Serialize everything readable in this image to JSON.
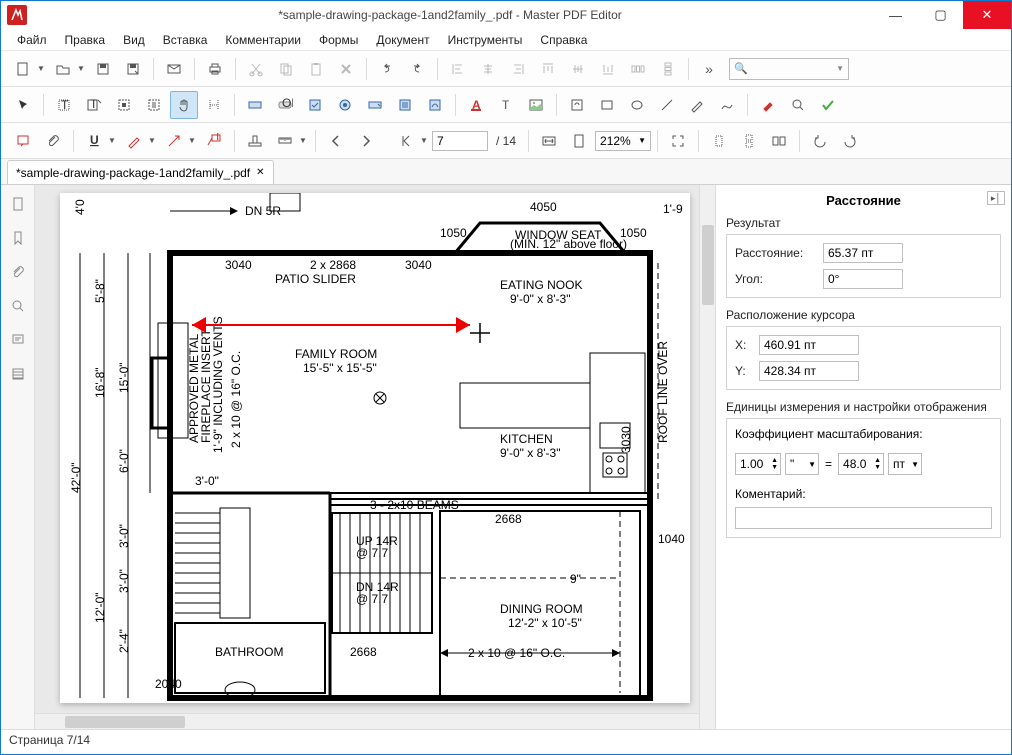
{
  "window": {
    "title": "*sample-drawing-package-1and2family_.pdf - Master PDF Editor",
    "app_name": "Master PDF Editor"
  },
  "menu": [
    "Файл",
    "Правка",
    "Вид",
    "Вставка",
    "Комментарии",
    "Формы",
    "Документ",
    "Инструменты",
    "Справка"
  ],
  "toolbar": {
    "search_icon": "🔍",
    "page_current": "7",
    "page_total": "/ 14",
    "zoom": "212%"
  },
  "tab": {
    "label": "*sample-drawing-package-1and2family_.pdf",
    "close": "✕"
  },
  "status": {
    "text": "Страница 7/14"
  },
  "side": {
    "title": "Расстояние",
    "result_heading": "Результат",
    "distance_label": "Расстояние:",
    "distance_value": "65.37 пт",
    "angle_label": "Угол:",
    "angle_value": "0°",
    "cursor_heading": "Расположение курсора",
    "x_label": "X:",
    "x_value": "460.91 пт",
    "y_label": "Y:",
    "y_value": "428.34 пт",
    "units_heading": "Единицы измерения и настройки отображения",
    "scale_label": "Коэффициент масштабирования:",
    "scale_a": "1.00",
    "scale_unit_a": "\"",
    "equals": "=",
    "scale_b": "48.0",
    "scale_unit_b": "пт",
    "comment_label": "Коментарий:",
    "comment_value": ""
  },
  "floorplan": {
    "dn5r": "DN 5R",
    "d4050": "4050",
    "d1050a": "1050",
    "d1050b": "1050",
    "d19": "1'-9",
    "d40": "4'0",
    "window_seat": "WINDOW SEAT",
    "window_seat_sub": "(MIN. 12\" above floor)",
    "d3040a": "3040",
    "d2x2868": "2 x 2868",
    "d3040b": "3040",
    "patio_slider": "PATIO SLIDER",
    "eating_nook": "EATING NOOK",
    "eating_nook_dim": "9'-0\" x 8'-3\"",
    "family_room": "FAMILY ROOM",
    "family_room_dim": "15'-5\" x 15'-5\"",
    "kitchen": "KITCHEN",
    "kitchen_dim": "9'-0\" x 8'-3\"",
    "roof_line": "ROOF LINE OVER",
    "approved_metal": "APPROVED METAL",
    "fireplace_insert": "FIREPLACE INSERT",
    "including_vents": "1'-9\" INCLUDING VENTS",
    "d2x10_16": "2 x 10 @ 16\" O.C.",
    "d58": "5'-8\"",
    "d168": "16'-8\"",
    "d150": "15'-0\"",
    "d60": "6'-0\"",
    "d30a": "3'-0\"",
    "d3030": "3030",
    "beams": "3 - 2x10 BEAMS",
    "d2668a": "2668",
    "up14r": "UP 14R",
    "up14r_sub": "@ 7.7",
    "dn14r": "DN 14R",
    "dn14r_sub": "@ 7.7",
    "d1040": "1040",
    "d9in": "9\"",
    "dining_room": "DINING ROOM",
    "dining_room_dim": "12'-2\" x 10'-5\"",
    "bathroom": "BATHROOM",
    "d2668b": "2668",
    "d2x10_16b": "2 x 10 @ 16\" O.C.",
    "d2040": "2040",
    "d120": "12'-0\"",
    "d24": "2'-4\"",
    "d30b": "3'-0\"",
    "d30c": "3'-0\"",
    "d420": "42'-0\""
  }
}
